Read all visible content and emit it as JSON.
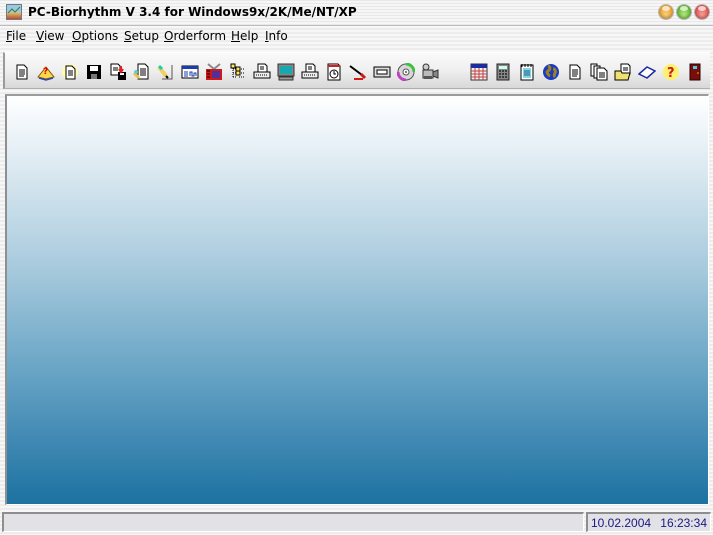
{
  "window": {
    "title": "PC-Biorhythm V 3.4 for Windows9x/2K/Me/NT/XP",
    "controls": [
      "minimize",
      "maximize",
      "close"
    ]
  },
  "menu": [
    {
      "label": "File",
      "mnemonic": "F",
      "rest": "ile"
    },
    {
      "label": "View",
      "mnemonic": "V",
      "rest": "iew"
    },
    {
      "label": "Options",
      "mnemonic": "O",
      "rest": "ptions"
    },
    {
      "label": "Setup",
      "mnemonic": "S",
      "rest": "etup"
    },
    {
      "label": "Orderform",
      "mnemonic": "O",
      "rest": "rderform"
    },
    {
      "label": "Help",
      "mnemonic": "H",
      "rest": "elp"
    },
    {
      "label": "Info",
      "mnemonic": "I",
      "rest": "nfo"
    }
  ],
  "toolbar": {
    "buttons": [
      {
        "icon": "new-document-icon"
      },
      {
        "icon": "help-book-icon"
      },
      {
        "icon": "new-sparkle-document-icon"
      },
      {
        "icon": "save-floppy-icon"
      },
      {
        "icon": "save-as-icon"
      },
      {
        "icon": "edit-document-icon"
      },
      {
        "icon": "edit-pen-icon"
      },
      {
        "icon": "window-chart-icon"
      },
      {
        "icon": "film-icon"
      },
      {
        "icon": "tree-list-icon"
      },
      {
        "icon": "print-icon"
      },
      {
        "icon": "monitor-icon"
      },
      {
        "icon": "print-preview-icon"
      },
      {
        "icon": "calendar-clock-icon"
      },
      {
        "icon": "paint-brush-icon"
      },
      {
        "icon": "message-icon"
      },
      {
        "icon": "cd-icon"
      },
      {
        "icon": "video-camera-icon"
      },
      {
        "icon": "calendar-grid-icon"
      },
      {
        "icon": "calculator-icon"
      },
      {
        "icon": "notepad-icon"
      },
      {
        "icon": "globe-icon"
      },
      {
        "icon": "document-icon"
      },
      {
        "icon": "multiple-documents-icon"
      },
      {
        "icon": "open-folder-icon"
      },
      {
        "icon": "open-book-icon"
      },
      {
        "icon": "question-icon"
      },
      {
        "icon": "exit-door-icon"
      }
    ]
  },
  "statusbar": {
    "message": "",
    "date": "10.02.2004",
    "time": "16:23:34"
  }
}
